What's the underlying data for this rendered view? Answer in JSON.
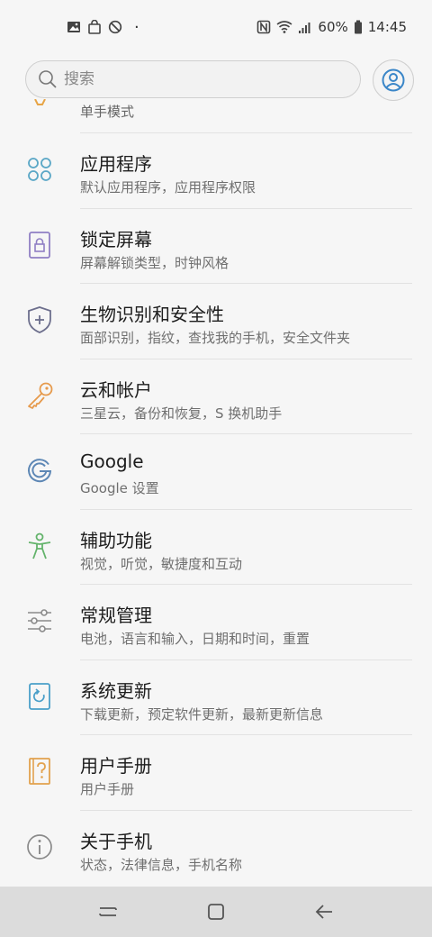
{
  "status_bar": {
    "dot": "·",
    "battery": "60%",
    "time": "14:45"
  },
  "search": {
    "placeholder": "搜索"
  },
  "partial_item": {
    "subtitle": "单手模式"
  },
  "items": [
    {
      "title": "应用程序",
      "subtitle": "默认应用程序，应用程序权限",
      "icon": "apps-icon",
      "color": "#5aa7c6"
    },
    {
      "title": "锁定屏幕",
      "subtitle": "屏幕解锁类型，时钟风格",
      "icon": "lock-screen-icon",
      "color": "#8f7fc4"
    },
    {
      "title": "生物识别和安全性",
      "subtitle": "面部识别，指纹，查找我的手机，安全文件夹",
      "icon": "shield-icon",
      "color": "#6d6f8d"
    },
    {
      "title": "云和帐户",
      "subtitle": "三星云，备份和恢复，S 换机助手",
      "icon": "key-icon",
      "color": "#e69a4c"
    },
    {
      "title": "Google",
      "subtitle": "Google 设置",
      "icon": "google-icon",
      "color": "#5d87b5"
    },
    {
      "title": "辅助功能",
      "subtitle": "视觉，听觉，敏捷度和互动",
      "icon": "accessibility-icon",
      "color": "#63b36b"
    },
    {
      "title": "常规管理",
      "subtitle": "电池，语言和输入，日期和时间，重置",
      "icon": "sliders-icon",
      "color": "#8a8a8a"
    },
    {
      "title": "系统更新",
      "subtitle": "下载更新，预定软件更新，最新更新信息",
      "icon": "system-update-icon",
      "color": "#4a9fc9"
    },
    {
      "title": "用户手册",
      "subtitle": "用户手册",
      "icon": "user-manual-icon",
      "color": "#e2a24e"
    },
    {
      "title": "关于手机",
      "subtitle": "状态，法律信息，手机名称",
      "icon": "info-icon",
      "color": "#8a8a8a"
    }
  ],
  "nav_bar": {
    "buttons": [
      "recent-apps",
      "home",
      "back"
    ]
  }
}
